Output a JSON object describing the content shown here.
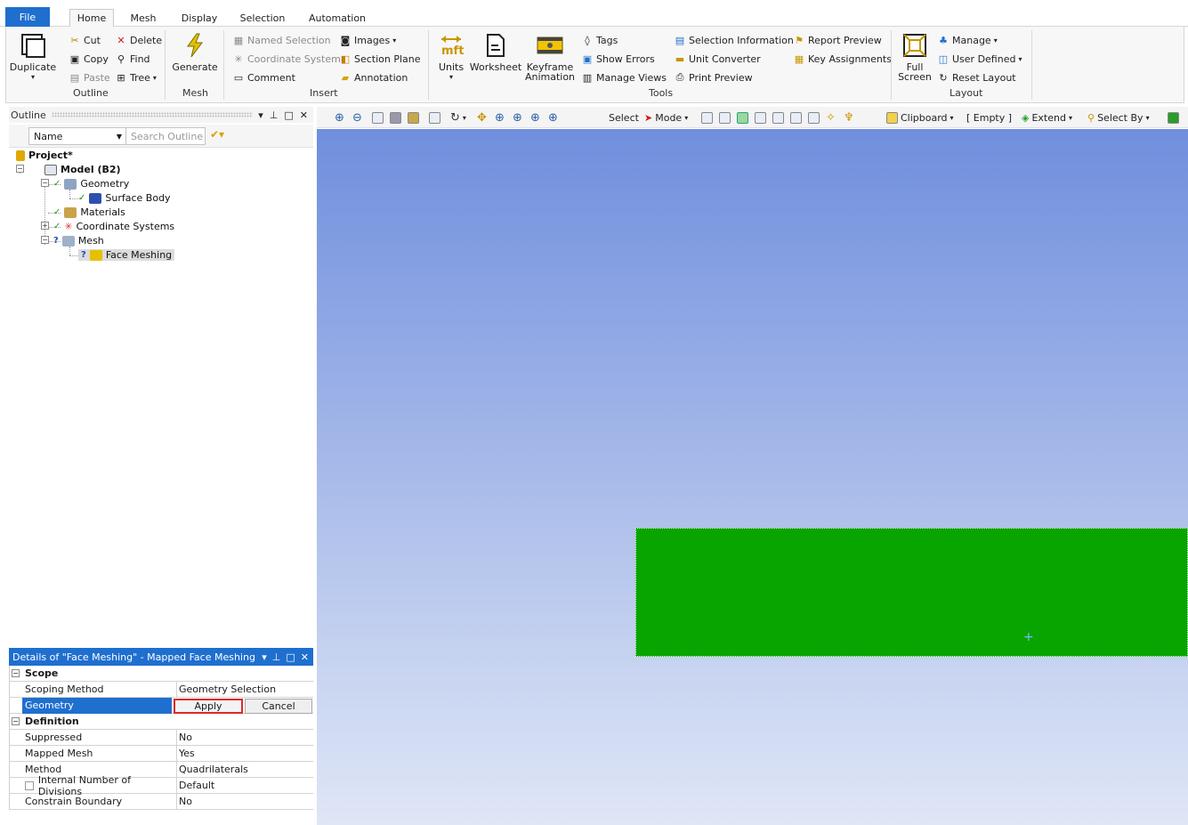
{
  "menu": {
    "file": "File",
    "tabs": [
      "Home",
      "Mesh",
      "Display",
      "Selection",
      "Automation"
    ],
    "active_tab": "Home"
  },
  "ribbon": {
    "outline_group": {
      "duplicate": "Duplicate",
      "cut": "Cut",
      "delete": "Delete",
      "copy": "Copy",
      "find": "Find",
      "paste": "Paste",
      "tree": "Tree",
      "label": "Outline"
    },
    "mesh_group": {
      "generate": "Generate",
      "label": "Mesh"
    },
    "insert_group": {
      "named_selection": "Named Selection",
      "images": "Images",
      "coordinate_system": "Coordinate System",
      "section_plane": "Section Plane",
      "comment": "Comment",
      "annotation": "Annotation",
      "label": "Insert"
    },
    "tools_group": {
      "units": "Units",
      "worksheet": "Worksheet",
      "keyframe": "Keyframe",
      "animation": "Animation",
      "tags": "Tags",
      "show_errors": "Show Errors",
      "manage_views": "Manage Views",
      "selection_information": "Selection Information",
      "unit_converter": "Unit Converter",
      "print_preview": "Print Preview",
      "report_preview": "Report Preview",
      "key_assignments": "Key Assignments",
      "label": "Tools"
    },
    "layout_group": {
      "full": "Full",
      "screen": "Screen",
      "manage": "Manage",
      "user_defined": "User Defined",
      "reset_layout": "Reset Layout",
      "label": "Layout"
    }
  },
  "outline": {
    "title": "Outline",
    "name_select": "Name",
    "search_placeholder": "Search Outline",
    "tree": {
      "project": "Project*",
      "model": "Model (B2)",
      "geometry": "Geometry",
      "surface_body": "Surface Body",
      "materials": "Materials",
      "coordinate_systems": "Coordinate Systems",
      "mesh": "Mesh",
      "face_meshing": "Face Meshing"
    }
  },
  "details": {
    "title": "Details of \"Face Meshing\" - Mapped Face Meshing",
    "sections": {
      "scope": "Scope",
      "definition": "Definition"
    },
    "rows": {
      "scoping_method": {
        "key": "Scoping Method",
        "value": "Geometry Selection"
      },
      "geometry": {
        "key": "Geometry"
      },
      "suppressed": {
        "key": "Suppressed",
        "value": "No"
      },
      "mapped_mesh": {
        "key": "Mapped Mesh",
        "value": "Yes"
      },
      "method": {
        "key": "Method",
        "value": "Quadrilaterals"
      },
      "internal_divisions": {
        "key": "Internal Number of Divisions",
        "value": "Default"
      },
      "constrain_boundary": {
        "key": "Constrain Boundary",
        "value": "No"
      }
    },
    "apply": "Apply",
    "cancel": "Cancel"
  },
  "graphics_toolbar": {
    "select": "Select",
    "mode": "Mode",
    "clipboard": "Clipboard",
    "empty": "[ Empty ]",
    "extend": "Extend",
    "select_by": "Select By"
  },
  "colors": {
    "accent": "#1f6fcf",
    "face": "#08a400",
    "apply_border": "#d92b2b"
  }
}
